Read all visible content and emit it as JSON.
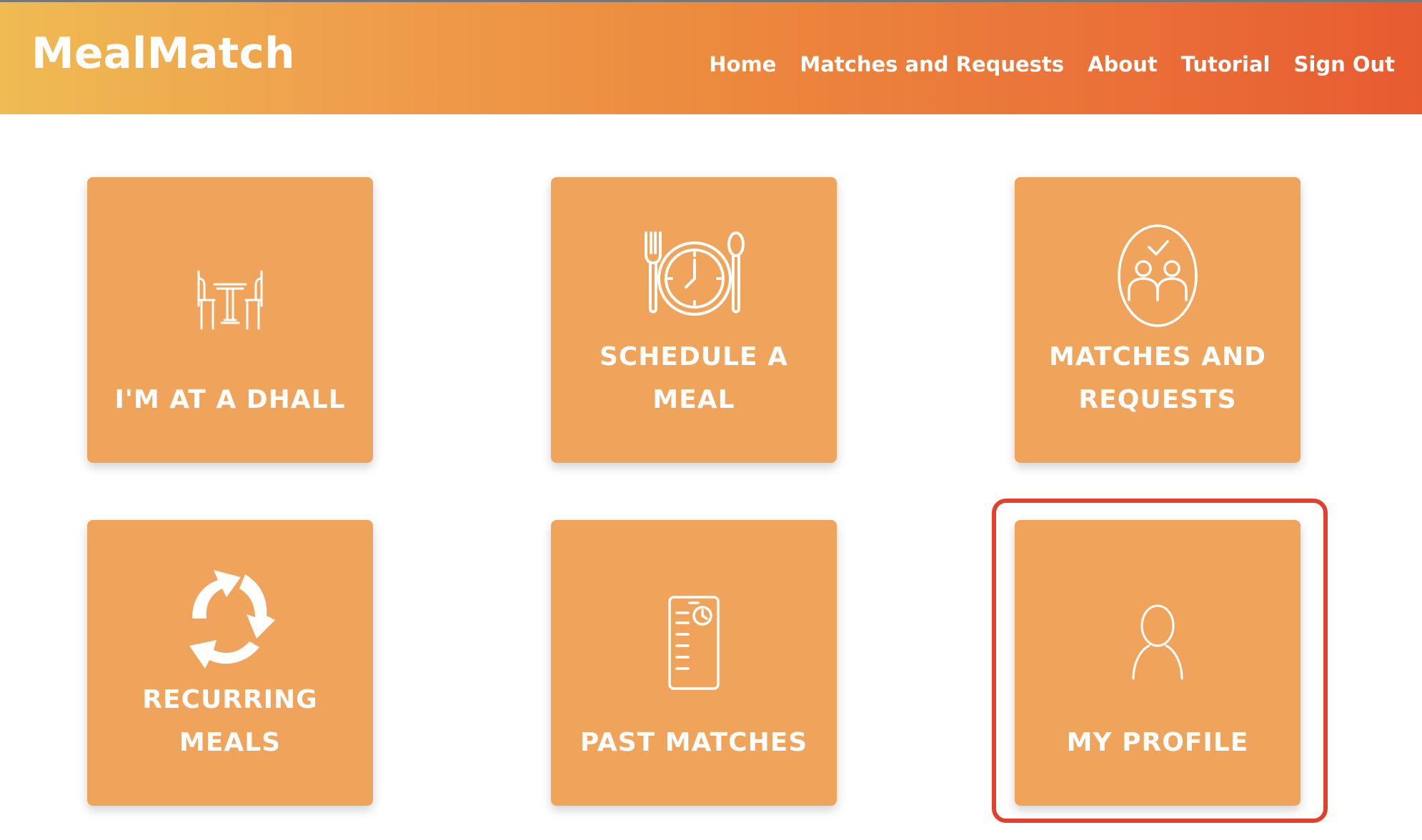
{
  "header": {
    "brand": "MealMatch",
    "nav": [
      "Home",
      "Matches and Requests",
      "About",
      "Tutorial",
      "Sign Out"
    ]
  },
  "tiles": [
    {
      "label": "I'M AT A DHALL",
      "icon": "dining-table-icon"
    },
    {
      "label": "SCHEDULE A MEAL",
      "icon": "plate-clock-icon"
    },
    {
      "label": "MATCHES AND REQUESTS",
      "icon": "people-check-icon"
    },
    {
      "label": "RECURRING MEALS",
      "icon": "recycle-arrows-icon"
    },
    {
      "label": "PAST MATCHES",
      "icon": "history-list-icon"
    },
    {
      "label": "MY PROFILE",
      "icon": "user-icon"
    }
  ],
  "colors": {
    "tile": "#f0a45b",
    "header_start": "#efbb52",
    "header_end": "#e75b31",
    "highlight": "#e43f2c"
  }
}
